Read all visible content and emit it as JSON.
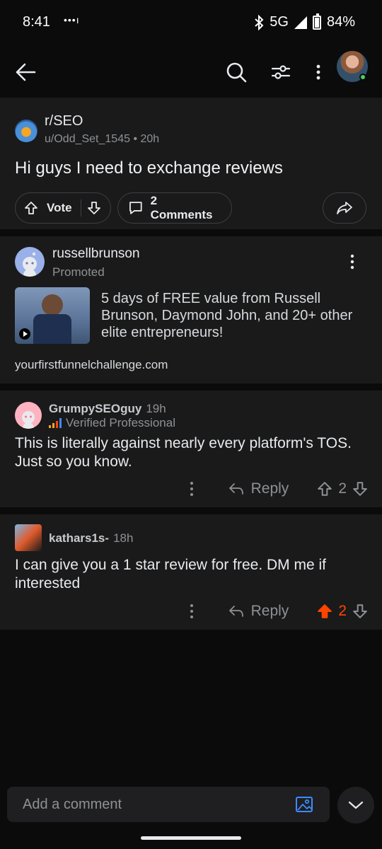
{
  "status_bar": {
    "time": "8:41",
    "dots": "•••ı",
    "network": "5G",
    "battery": "84%"
  },
  "header": {
    "icons": [
      "back-arrow-icon",
      "search-icon",
      "filter-icon",
      "more-vertical-icon",
      "user-avatar"
    ]
  },
  "post": {
    "subreddit": "r/SEO",
    "meta": "u/Odd_Set_1545 • 20h",
    "title": "Hi guys I need to exchange reviews",
    "vote_label": "Vote",
    "comments_label": "2 Comments"
  },
  "ad": {
    "advertiser": "russellbrunson",
    "promoted": "Promoted",
    "text": "5 days of FREE value from Russell Brunson, Daymond John, and 20+ other elite entrepreneurs!",
    "url": "yourfirstfunnelchallenge.com"
  },
  "comments": [
    {
      "user": "GrumpySEOguy",
      "time": "19h",
      "flair": "Verified Professional",
      "body": "This is literally against nearly every platform's TOS. Just so you know.",
      "reply_label": "Reply",
      "score": "2",
      "upvoted": false
    },
    {
      "user": "kathars1s-",
      "time": "18h",
      "body": "I can give you a 1 star review for free. DM me if interested",
      "reply_label": "Reply",
      "score": "2",
      "upvoted": true
    }
  ],
  "bottom": {
    "comment_placeholder": "Add a comment"
  },
  "colors": {
    "upvote": "#ff4500",
    "card": "#1a1a1b",
    "background": "#0b0b0b",
    "link_blue": "#3d8bfd"
  }
}
